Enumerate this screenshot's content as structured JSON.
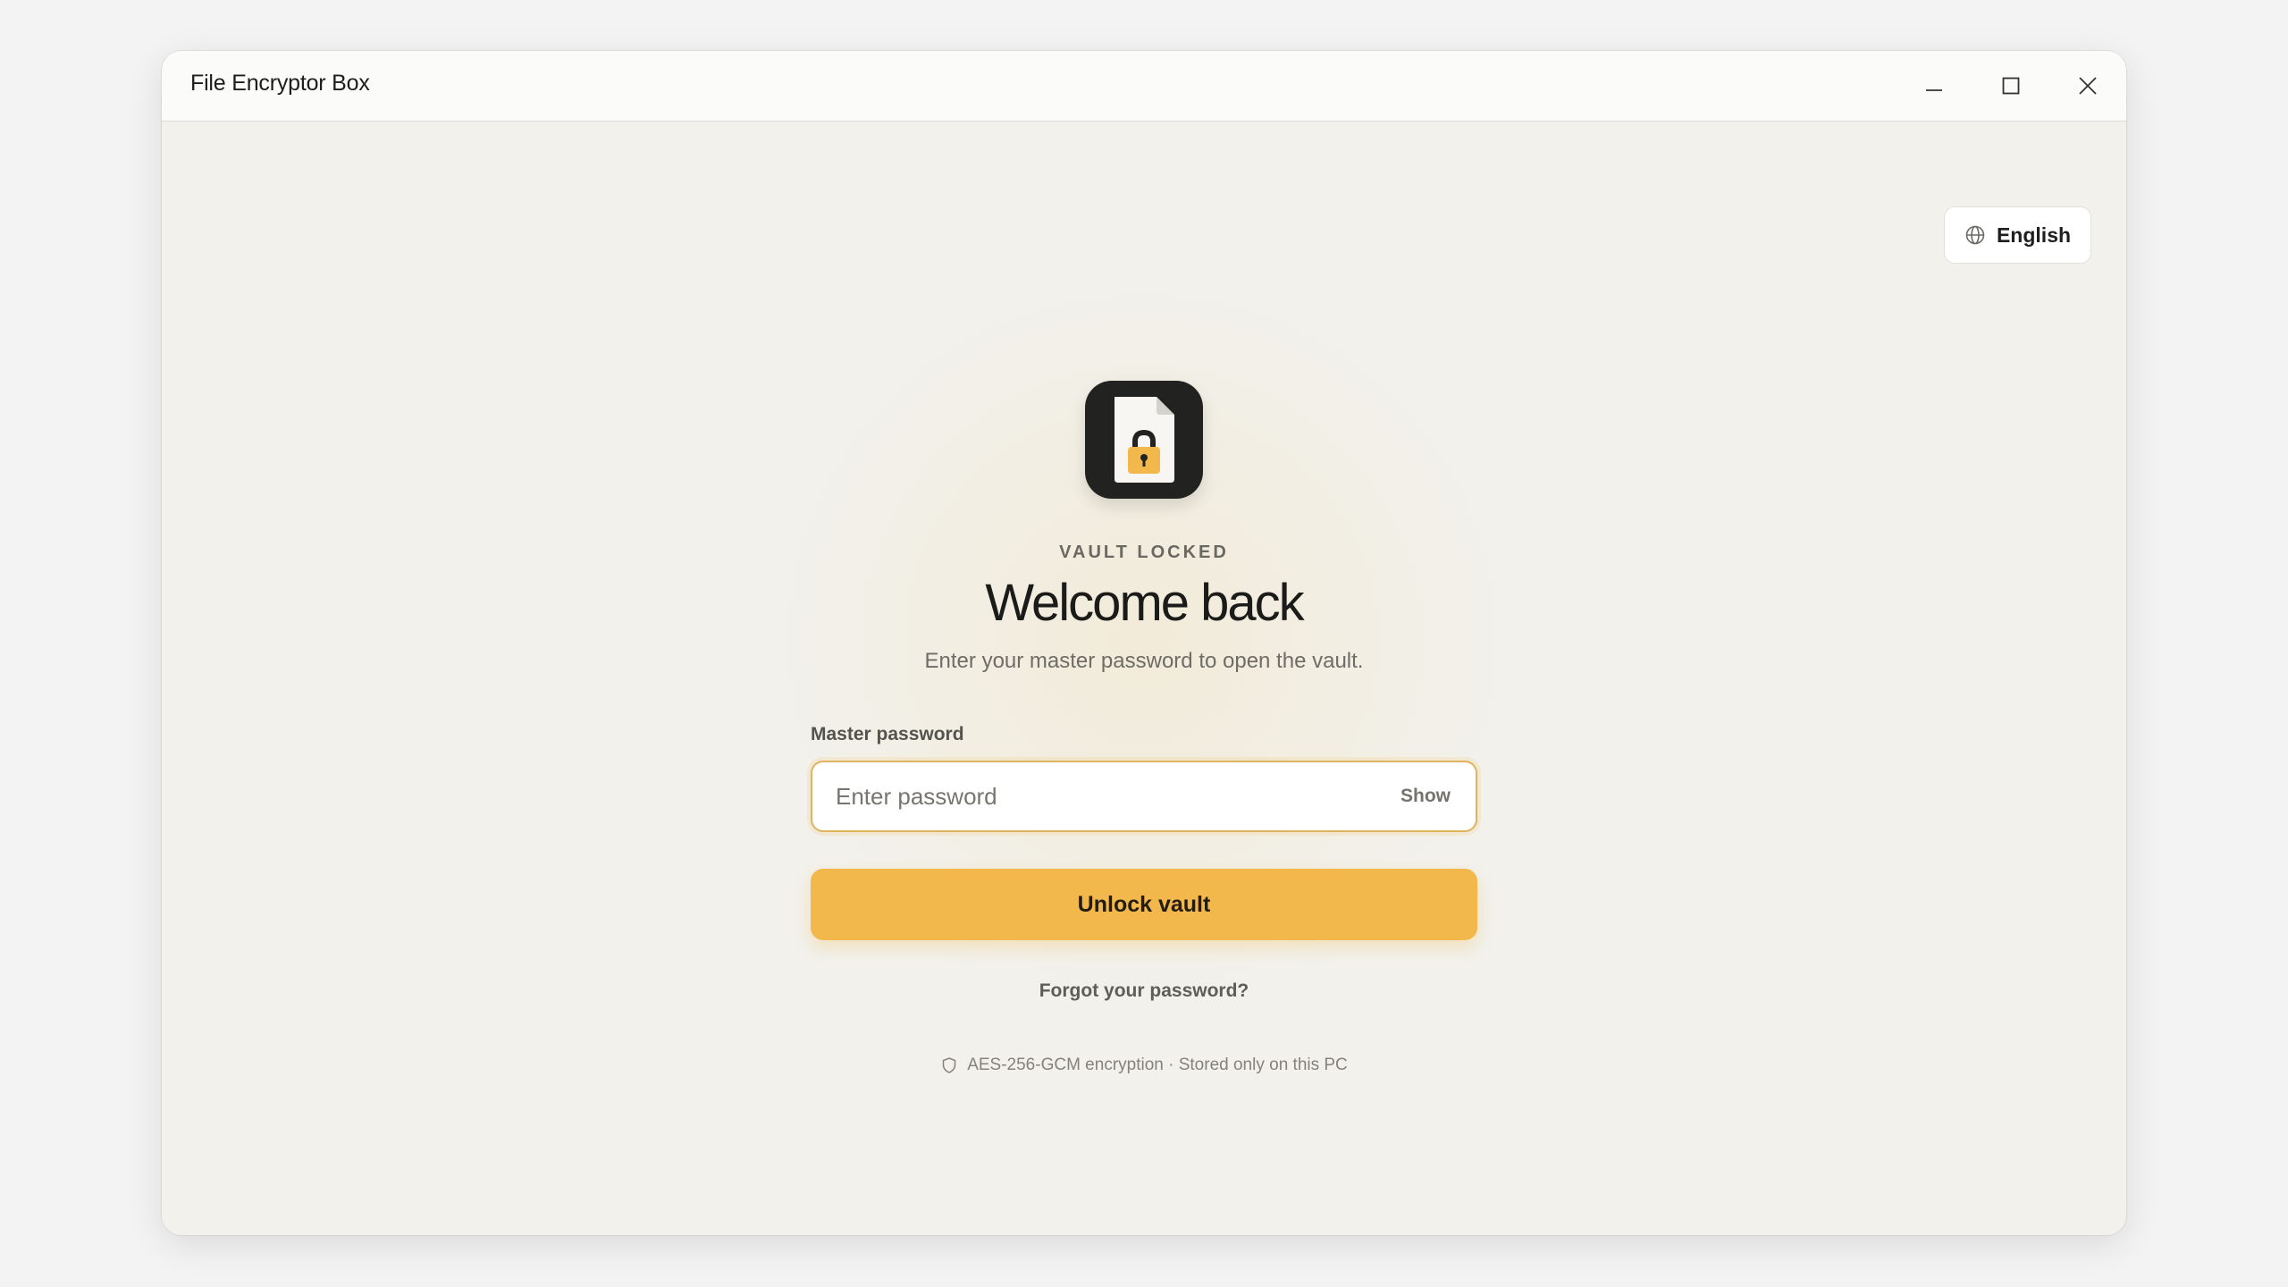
{
  "window": {
    "title": "File Encryptor Box"
  },
  "language": {
    "label": "English",
    "icon": "globe-icon"
  },
  "lock_screen": {
    "status": "VAULT LOCKED",
    "heading": "Welcome back",
    "subtitle": "Enter your master password to open the vault.",
    "password_label": "Master password",
    "password_placeholder": "Enter password",
    "password_value": "",
    "show_label": "Show",
    "unlock_label": "Unlock vault",
    "forgot_label": "Forgot your password?",
    "security_note": "AES-256-GCM encryption · Stored only on this PC"
  },
  "colors": {
    "accent": "#f2b84b",
    "logo_background": "#222220",
    "page_background": "#f2f1ec"
  }
}
